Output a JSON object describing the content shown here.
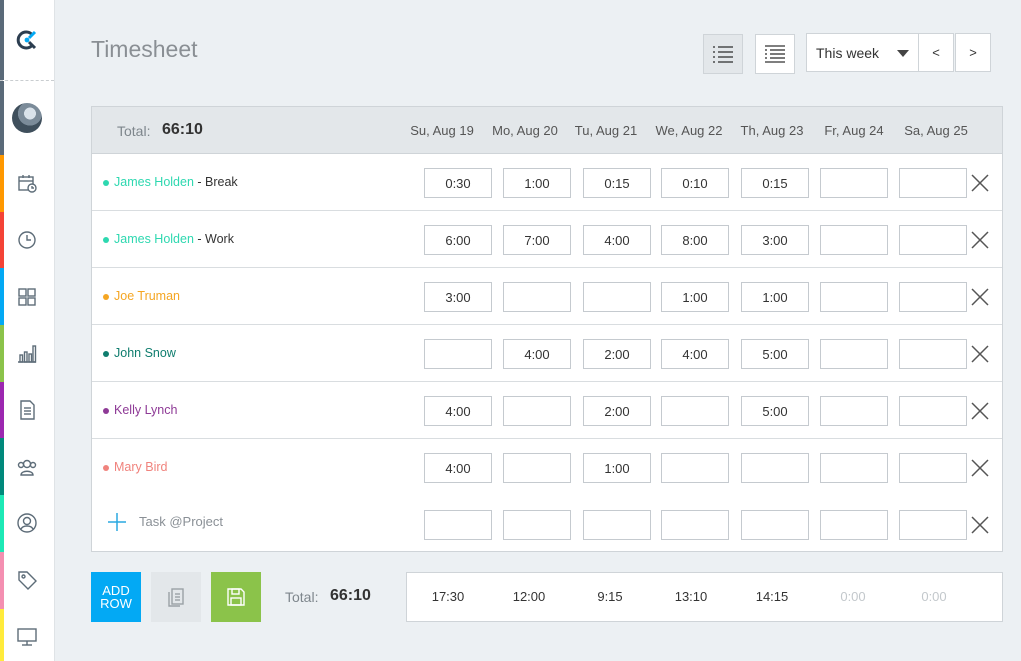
{
  "app": {
    "logo_icon": "clockify-logo-icon"
  },
  "sidebar": {
    "items": [
      {
        "icon": "calendar-clock-icon",
        "color": "#ff9800"
      },
      {
        "icon": "clock-icon",
        "color": "#f44336"
      },
      {
        "icon": "dashboard-grid-icon",
        "color": "#03a9f4"
      },
      {
        "icon": "bar-chart-icon",
        "color": "#8bc34a"
      },
      {
        "icon": "document-icon",
        "color": "#9c27b0"
      },
      {
        "icon": "team-icon",
        "color": "#00897b"
      },
      {
        "icon": "user-icon",
        "color": "#1de9b6"
      },
      {
        "icon": "tag-icon",
        "color": "#f48fb1"
      },
      {
        "icon": "desktop-icon",
        "color": "#ffeb3b"
      }
    ]
  },
  "header": {
    "title": "Timesheet",
    "week_select": "This week",
    "prev_label": "<",
    "next_label": ">"
  },
  "table": {
    "total_label": "Total:",
    "total_value": "66:10",
    "days": [
      "Su, Aug 19",
      "Mo, Aug 20",
      "Tu, Aug 21",
      "We, Aug 22",
      "Th, Aug 23",
      "Fr, Aug 24",
      "Sa, Aug 25"
    ],
    "rows": [
      {
        "project": "James Holden",
        "task": " - Break",
        "color": "#2ed8b0",
        "values": [
          "0:30",
          "1:00",
          "0:15",
          "0:10",
          "0:15",
          "",
          ""
        ]
      },
      {
        "project": "James Holden",
        "task": " - Work",
        "color": "#2ed8b0",
        "values": [
          "6:00",
          "7:00",
          "4:00",
          "8:00",
          "3:00",
          "",
          ""
        ]
      },
      {
        "project": "Joe Truman",
        "task": "",
        "color": "#f5a623",
        "values": [
          "3:00",
          "",
          "",
          "1:00",
          "1:00",
          "",
          ""
        ]
      },
      {
        "project": "John Snow",
        "task": "",
        "color": "#0f7d6e",
        "values": [
          "",
          "4:00",
          "2:00",
          "4:00",
          "5:00",
          "",
          ""
        ]
      },
      {
        "project": "Kelly Lynch",
        "task": "",
        "color": "#8e3a96",
        "values": [
          "4:00",
          "",
          "2:00",
          "",
          "5:00",
          "",
          ""
        ]
      },
      {
        "project": "Mary Bird",
        "task": "",
        "color": "#f0837d",
        "values": [
          "4:00",
          "",
          "1:00",
          "",
          "",
          "",
          ""
        ]
      }
    ],
    "new_row_placeholder": "Task @Project"
  },
  "footer": {
    "add_row_label_1": "ADD",
    "add_row_label_2": "ROW",
    "total_label": "Total:",
    "total_value": "66:10",
    "day_totals": [
      "17:30",
      "12:00",
      "9:15",
      "13:10",
      "14:15",
      "0:00",
      "0:00"
    ]
  }
}
